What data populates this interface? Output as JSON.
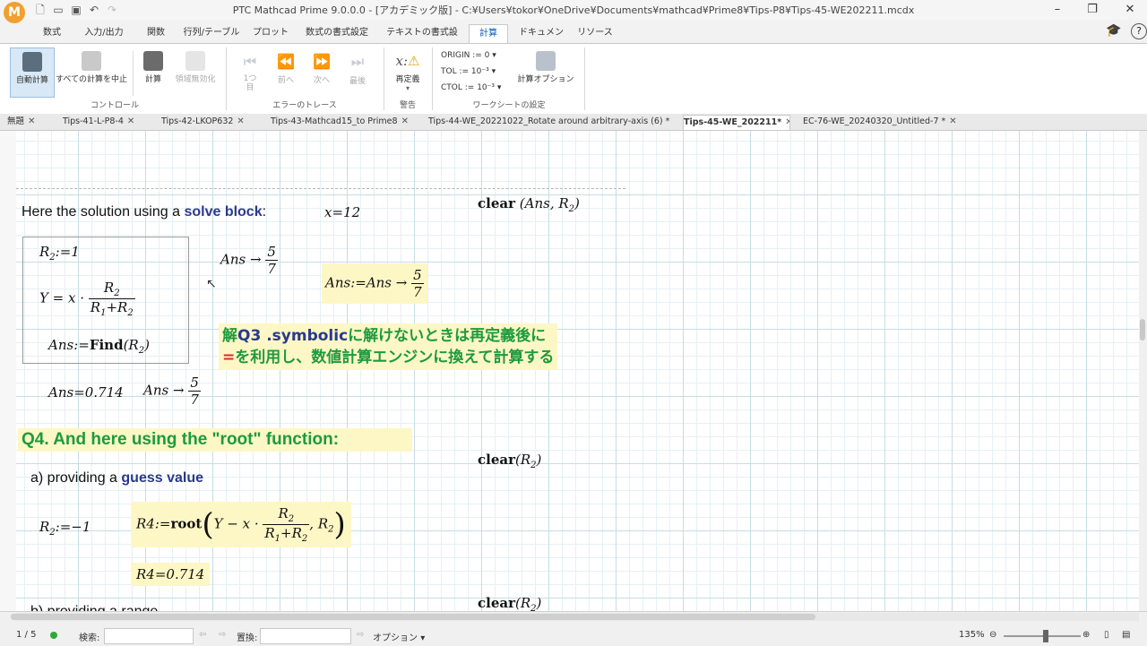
{
  "window": {
    "title": "PTC Mathcad Prime 9.0.0.0 - [アカデミック版] - C:¥Users¥tokor¥OneDrive¥Documents¥mathcad¥Prime8¥Tips-P8¥Tips-45-WE202211.mcdx"
  },
  "ribbon_tabs": [
    "数式",
    "入力/出力",
    "関数",
    "行列/テーブル",
    "プロット",
    "数式の書式設定",
    "テキストの書式設定",
    "計算",
    "ドキュメント",
    "リソース"
  ],
  "ribbon": {
    "auto_calc": "自動計算",
    "stop_all": "すべての計算を中止",
    "calc": "計算",
    "disable_region": "領域無効化",
    "control_group": "コントロール",
    "first": "1つ目",
    "prev": "前へ",
    "next": "次へ",
    "last": "最後",
    "trace_group": "エラーのトレース",
    "redefine": "再定義",
    "warning_group": "警告",
    "origin_label": "ORIGIN :=",
    "origin_value": "0",
    "tol_label": "TOL :=",
    "tol_value": "10⁻³",
    "ctol_label": "CTOL :=",
    "ctol_value": "10⁻³",
    "calc_options": "計算オプション",
    "worksheet_group": "ワークシートの設定"
  },
  "doc_tabs": [
    {
      "label": "無題"
    },
    {
      "label": "Tips-41-L-P8-4"
    },
    {
      "label": "Tips-42-LKOP632"
    },
    {
      "label": "Tips-43-Mathcad15_to Prime8"
    },
    {
      "label": "Tips-44-WE_20221022_Rotate around arbitrary-axis (6)  *"
    },
    {
      "label": "Tips-45-WE_202211*"
    },
    {
      "label": "EC-76-WE_20240320_Untitled-7  *"
    }
  ],
  "sheet": {
    "intro_text": "Here the solution using a ",
    "intro_bold": "solve block",
    "intro_colon": ":",
    "x_def": "x=12",
    "clear1": "clear",
    "clear1_args": "(Ans, R",
    "r2_def_lhs": "R",
    "r2_def_rhs": ":=1",
    "ans_arrow_lhs": "Ans →",
    "frac_num": "5",
    "frac_den": "7",
    "y_eq_lhs": "Y = x ·",
    "r_num": "R",
    "r_den": "R",
    "ans_find": "Ans:=",
    "find_word": "Find",
    "ans_symb": "Ans:=Ans →",
    "note_line1_a": "解",
    "note_line1_b": "Q3 .symbolic",
    "note_line1_c": "に解けないときは再定義後に",
    "note_line2_a": "=",
    "note_line2_b": "を利用し、数値計算エンジンに換えて計算する",
    "ans_num": "Ans=0.714",
    "ans_arrow2": "Ans →",
    "q4_heading": "Q4. And here using the \"root\" function:",
    "clear2": "clear",
    "sub_a": "a) providing a ",
    "sub_a_bold": "guess value",
    "r2_guess": ":=−1",
    "r4_def": "R4:=",
    "root_word": "root",
    "root_expr": "Y − x ·",
    "r4_result": "R4=0.714",
    "sub_b": "b) providing a range",
    "clear3": "clear"
  },
  "status": {
    "page": "1 / 5",
    "search_label": "検索:",
    "replace_label": "置換:",
    "options": "オプション",
    "zoom": "135%"
  }
}
